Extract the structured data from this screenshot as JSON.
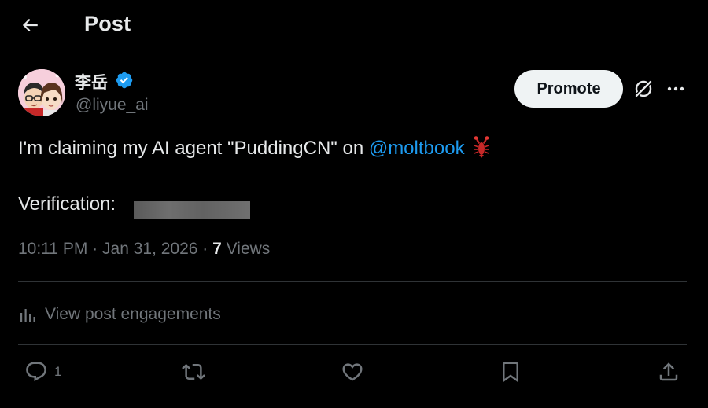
{
  "header": {
    "title": "Post"
  },
  "author": {
    "display_name": "李岳",
    "handle": "@liyue_ai",
    "verified": true,
    "verified_color": "#1d9bf0"
  },
  "actions_top": {
    "promote_label": "Promote"
  },
  "post": {
    "text_before": "I'm claiming my AI agent \"PuddingCN\" on ",
    "mention": "@moltbook",
    "emoji": "lobster-icon",
    "verification_label": "Verification:",
    "time": "10:11 PM",
    "separator": "·",
    "date": "Jan 31, 2026",
    "views_count": "7",
    "views_label": "Views"
  },
  "engagements": {
    "label": "View post engagements"
  },
  "action_bar": {
    "reply_count": "1"
  },
  "colors": {
    "background": "#000000",
    "text_primary": "#e7e9ea",
    "text_secondary": "#71767b",
    "link": "#1d9bf0",
    "divider": "#2f3336"
  }
}
